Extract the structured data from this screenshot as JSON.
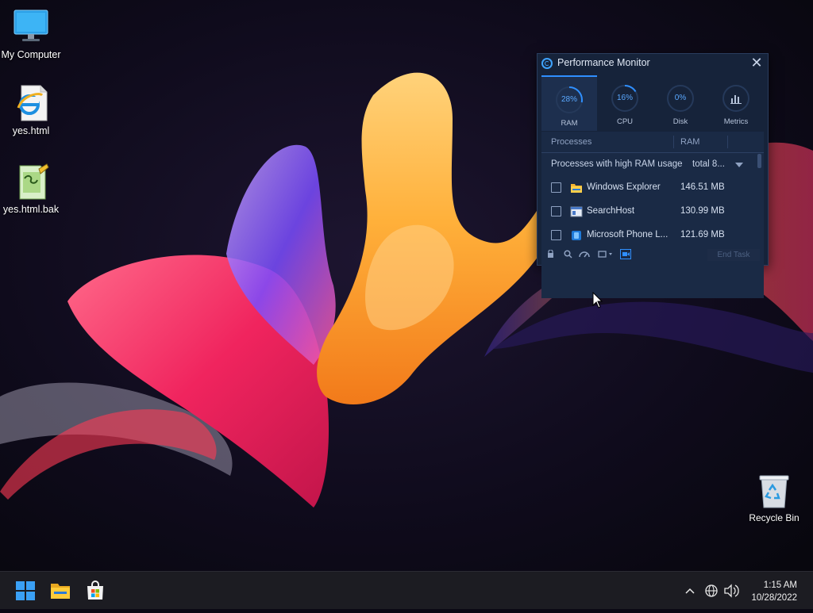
{
  "desktop": {
    "icons": [
      {
        "label": "My Computer",
        "icon": "monitor-icon"
      },
      {
        "label": "yes.html",
        "icon": "internet-explorer-icon"
      },
      {
        "label": "yes.html.bak",
        "icon": "notepad-file-icon"
      }
    ],
    "recycle_bin": {
      "label": "Recycle Bin",
      "icon": "recycle-bin-icon"
    }
  },
  "perf_monitor": {
    "title": "Performance Monitor",
    "tabs": [
      {
        "label": "RAM",
        "value": "28%",
        "fraction": 0.28
      },
      {
        "label": "CPU",
        "value": "16%",
        "fraction": 0.16
      },
      {
        "label": "Disk",
        "value": "0%",
        "fraction": 0.0
      },
      {
        "label": "Metrics",
        "value": "",
        "fraction": 0
      }
    ],
    "columns": {
      "processes": "Processes",
      "ram": "RAM"
    },
    "group": {
      "label": "Processes with high RAM usage",
      "total": "total 8..."
    },
    "rows": [
      {
        "name": "Windows Explorer",
        "ram": "146.51 MB",
        "icon": "folder-icon"
      },
      {
        "name": "SearchHost",
        "ram": "130.99 MB",
        "icon": "window-app-icon"
      },
      {
        "name": "Microsoft Phone L...",
        "ram": "121.69 MB",
        "icon": "phone-link-icon"
      }
    ],
    "end_task": "End Task"
  },
  "taskbar": {
    "clock_time": "1:15 AM",
    "clock_date": "10/28/2022"
  },
  "colors": {
    "accent": "#2f8fff",
    "panel_bg": "#16233a",
    "taskbar_bg": "#1c1c22"
  }
}
